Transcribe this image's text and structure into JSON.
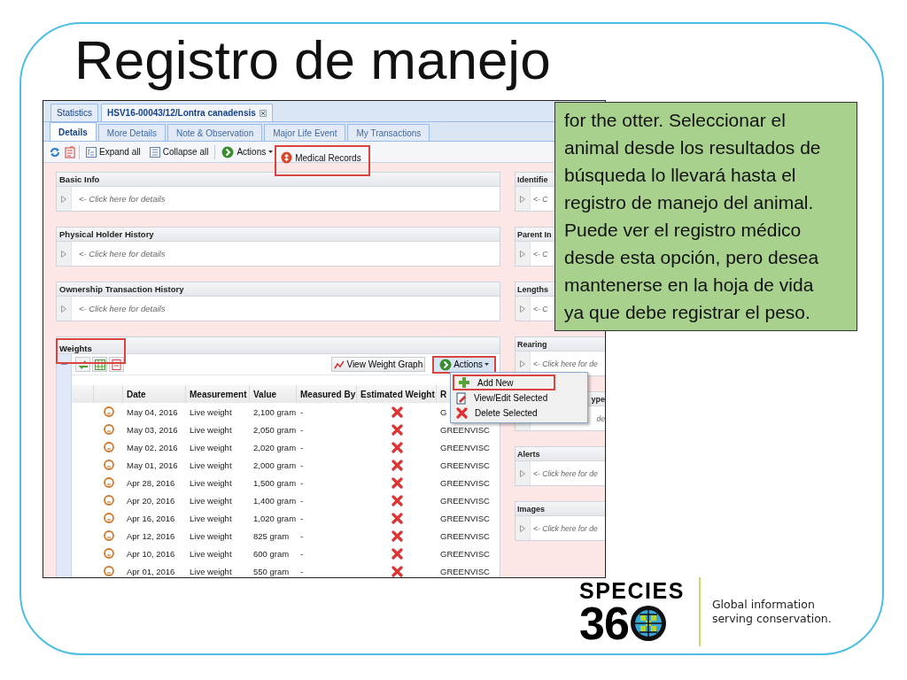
{
  "slide": {
    "title": "Registro de manejo"
  },
  "app": {
    "doc_tabs": [
      {
        "label": "Statistics",
        "selected": false,
        "closable": false
      },
      {
        "label": "HSV16-00043/12/Lontra canadensis",
        "selected": true,
        "closable": true
      }
    ],
    "sub_tabs": [
      {
        "label": "Details",
        "selected": true
      },
      {
        "label": "More Details",
        "selected": false
      },
      {
        "label": "Note & Observation",
        "selected": false
      },
      {
        "label": "Major Life Event",
        "selected": false
      },
      {
        "label": "My Transactions",
        "selected": false
      }
    ],
    "toolbar": [
      {
        "kind": "expand",
        "label": "Expand all",
        "highlighted": false
      },
      {
        "kind": "collapse",
        "label": "Collapse all",
        "highlighted": false
      },
      {
        "kind": "menu",
        "label": "Actions",
        "highlighted": false
      },
      {
        "kind": "medical",
        "label": "Medical Records",
        "highlighted": true
      }
    ],
    "left_panels": [
      {
        "title": "Basic Info",
        "body": "<- Click here for details"
      },
      {
        "title": "Physical Holder History",
        "body": "<- Click here for details"
      },
      {
        "title": "Ownership Transaction History",
        "body": "<- Click here for details"
      }
    ],
    "right_panels": [
      {
        "title": "Identifie",
        "body": "<- C",
        "covered": false
      },
      {
        "title": "Parent In",
        "body": "<- C",
        "covered": false
      },
      {
        "title": "Lengths",
        "body": "<- C",
        "covered": false
      },
      {
        "title": "Rearing",
        "body": "<- Click here for de",
        "covered": false
      },
      {
        "title": "ype",
        "body": "de",
        "covered": true
      },
      {
        "title": "Alerts",
        "body": "<- Click here for de",
        "covered": false
      },
      {
        "title": "Images",
        "body": "<- Click here for de",
        "covered": false
      }
    ],
    "weights": {
      "title": "Weights",
      "highlighted": true,
      "graph_button": "View Weight Graph",
      "actions": {
        "label": "Actions",
        "highlighted": true
      },
      "menu": [
        {
          "kind": "add",
          "label": "Add New",
          "highlighted": true
        },
        {
          "kind": "edit",
          "label": "View/Edit Selected",
          "highlighted": false
        },
        {
          "kind": "delete",
          "label": "Delete Selected",
          "highlighted": false
        }
      ],
      "columns": [
        "Date",
        "Measurement",
        "Value",
        "Measured By",
        "Estimated Weight",
        "R"
      ],
      "rows": [
        {
          "date": "May 04, 2016",
          "measurement": "Live weight",
          "value": "2,100 gram",
          "measured_by": "-",
          "estimated": false,
          "column_6": "G"
        },
        {
          "date": "May 03, 2016",
          "measurement": "Live weight",
          "value": "2,050 gram",
          "measured_by": "-",
          "estimated": false,
          "column_6": "GREENVISC"
        },
        {
          "date": "May 02, 2016",
          "measurement": "Live weight",
          "value": "2,020 gram",
          "measured_by": "-",
          "estimated": false,
          "column_6": "GREENVISC"
        },
        {
          "date": "May 01, 2016",
          "measurement": "Live weight",
          "value": "2,000 gram",
          "measured_by": "-",
          "estimated": false,
          "column_6": "GREENVISC"
        },
        {
          "date": "Apr 28, 2016",
          "measurement": "Live weight",
          "value": "1,500 gram",
          "measured_by": "-",
          "estimated": false,
          "column_6": "GREENVISC"
        },
        {
          "date": "Apr 20, 2016",
          "measurement": "Live weight",
          "value": "1,400 gram",
          "measured_by": "-",
          "estimated": false,
          "column_6": "GREENVISC"
        },
        {
          "date": "Apr 16, 2016",
          "measurement": "Live weight",
          "value": "1,020 gram",
          "measured_by": "-",
          "estimated": false,
          "column_6": "GREENVISC"
        },
        {
          "date": "Apr 12, 2016",
          "measurement": "Live weight",
          "value": "825 gram",
          "measured_by": "-",
          "estimated": false,
          "column_6": "GREENVISC"
        },
        {
          "date": "Apr 10, 2016",
          "measurement": "Live weight",
          "value": "600 gram",
          "measured_by": "-",
          "estimated": false,
          "column_6": "GREENVISC"
        },
        {
          "date": "Apr 01, 2016",
          "measurement": "Live weight",
          "value": "550 gram",
          "measured_by": "-",
          "estimated": false,
          "column_6": "GREENVISC"
        }
      ]
    }
  },
  "callout": {
    "text": "for the otter.  Seleccionar el animal desde los resultados de búsqueda lo llevará hasta el registro de manejo del animal. Puede ver el registro médico desde esta opción, pero desea mantenerse en la hoja de vida ya que debe registrar el peso."
  },
  "logo": {
    "wordmark": "SPECIES",
    "number": "36",
    "tagline": [
      "Global information",
      "serving conservation."
    ]
  }
}
